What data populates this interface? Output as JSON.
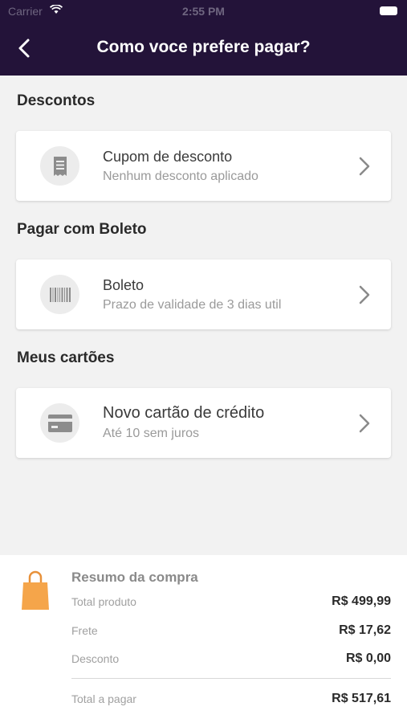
{
  "status_bar": {
    "carrier": "Carrier",
    "time": "2:55 PM"
  },
  "header": {
    "title": "Como voce prefere pagar?",
    "background_color": "#231339"
  },
  "sections": {
    "discounts": {
      "title": "Descontos",
      "card": {
        "title": "Cupom de desconto",
        "subtitle": "Nenhum desconto aplicado",
        "icon": "receipt-icon"
      }
    },
    "boleto": {
      "title": "Pagar com Boleto",
      "card": {
        "title": "Boleto",
        "subtitle": "Prazo de validade de 3 dias util",
        "icon": "barcode-icon"
      }
    },
    "cards": {
      "title": "Meus cartões",
      "card": {
        "title": "Novo cartão de crédito",
        "subtitle": "Até 10 sem juros",
        "icon": "credit-card-icon"
      }
    }
  },
  "summary": {
    "title": "Resumo da compra",
    "icon": "shopping-bag-icon",
    "accent_color": "#f5a54a",
    "rows": [
      {
        "label": "Total produto",
        "value": "R$ 499,99"
      },
      {
        "label": "Frete",
        "value": "R$ 17,62"
      },
      {
        "label": "Desconto",
        "value": "R$ 0,00"
      }
    ],
    "total": {
      "label": "Total a pagar",
      "value": "R$ 517,61"
    }
  }
}
